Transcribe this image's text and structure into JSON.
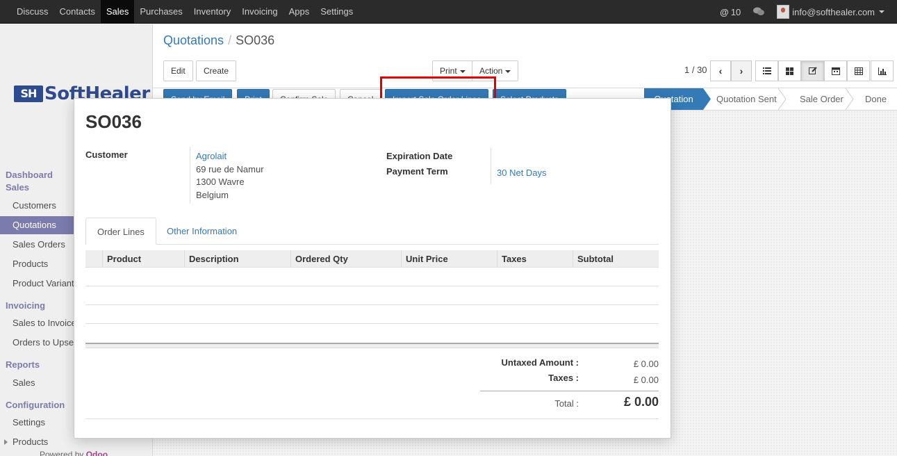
{
  "topnav": {
    "items": [
      "Discuss",
      "Contacts",
      "Sales",
      "Purchases",
      "Inventory",
      "Invoicing",
      "Apps",
      "Settings"
    ],
    "active": "Sales",
    "notifications": "10",
    "user_email": "info@softhealer.com"
  },
  "sidebar": {
    "logo_mark": "SH",
    "logo_text": "SoftHealer",
    "sections": {
      "dashboard": "Dashboard",
      "sales": "Sales",
      "invoicing": "Invoicing",
      "reports": "Reports",
      "configuration": "Configuration"
    },
    "items": {
      "customers": "Customers",
      "quotations": "Quotations",
      "sales_orders": "Sales Orders",
      "products": "Products",
      "product_variants": "Product Variants",
      "sales_to_invoice": "Sales to Invoice",
      "orders_to_upsell": "Orders to Upsell",
      "sales": "Sales",
      "settings": "Settings",
      "config_products": "Products"
    },
    "powered_prefix": "Powered by",
    "powered_brand": "Odoo"
  },
  "breadcrumb": {
    "parent": "Quotations",
    "current": "SO036"
  },
  "toolbar": {
    "edit": "Edit",
    "create": "Create",
    "print": "Print",
    "action": "Action",
    "pager": "1 / 30"
  },
  "header_buttons": {
    "send_email": "Send by Email",
    "print": "Print",
    "confirm": "Confirm Sale",
    "cancel": "Cancel",
    "import_lines": "Import Sale Order Lines",
    "select_products": "Select Products"
  },
  "statusbar": {
    "stages": [
      "Quotation",
      "Quotation Sent",
      "Sale Order",
      "Done"
    ],
    "active": "Quotation"
  },
  "form": {
    "name": "SO036",
    "customer_label": "Customer",
    "customer_name": "Agrolait",
    "address_line1": "69 rue de Namur",
    "address_line2": "1300 Wavre",
    "address_line3": "Belgium",
    "expiration_label": "Expiration Date",
    "payment_term_label": "Payment Term",
    "payment_term": "30 Net Days"
  },
  "tabs": {
    "order_lines": "Order Lines",
    "other_info": "Other Information"
  },
  "table": {
    "columns": [
      "Product",
      "Description",
      "Ordered Qty",
      "Unit Price",
      "Taxes",
      "Subtotal"
    ]
  },
  "totals": {
    "untaxed_label": "Untaxed Amount :",
    "untaxed": "£ 0.00",
    "taxes_label": "Taxes :",
    "taxes": "£ 0.00",
    "total_label": "Total :",
    "total": "£ 0.00"
  },
  "colors": {
    "primary": "#337ab7",
    "menu_accent": "#7c7bad",
    "highlight": "#e00000"
  }
}
